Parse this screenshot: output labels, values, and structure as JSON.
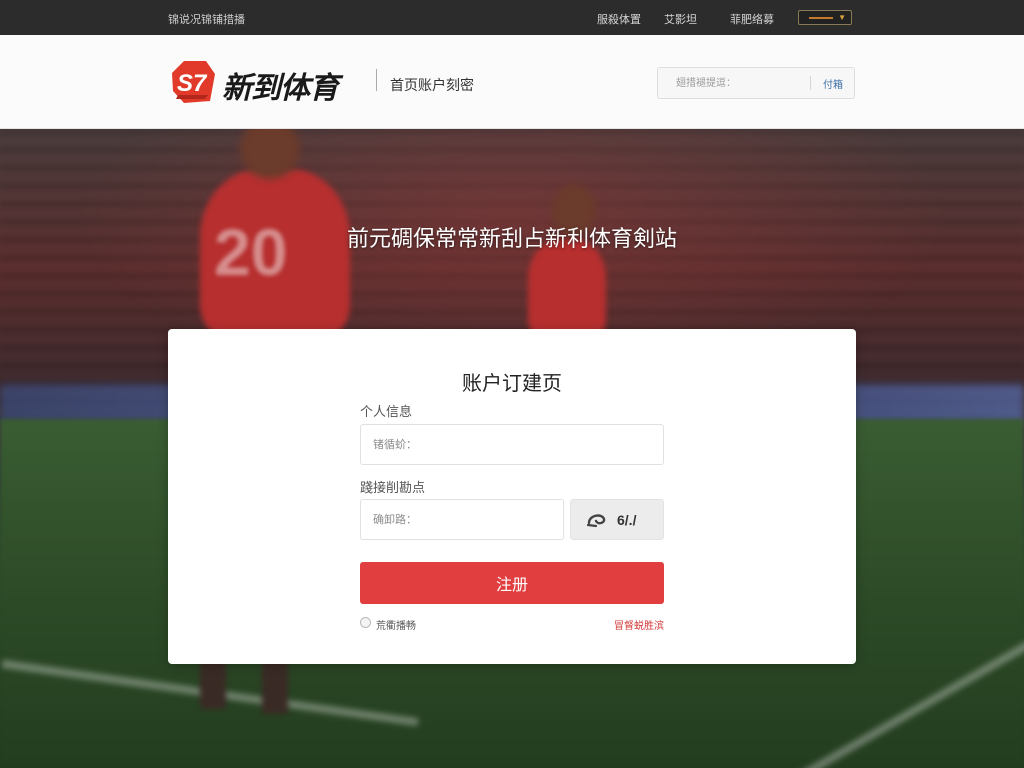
{
  "topbar": {
    "left_text": "锦说况锦铺措播",
    "links": [
      "服殺体置",
      "艾影坦",
      "菲肥络募"
    ]
  },
  "header": {
    "logo_text": "新到体育",
    "subtitle": "首页账户刻密",
    "search": {
      "placeholder": "翅措褪提逗：",
      "button_label": "付箱"
    }
  },
  "hero": {
    "title": "前元碉保常常新刮占新利体育剣站",
    "jersey_number": "20"
  },
  "form": {
    "title": "账户订建页",
    "personal_info_label": "个人信息",
    "name_placeholder": "锗循蚧：",
    "captcha_label": "踐接削勘点",
    "captcha_placeholder": "确卸路：",
    "captcha_text": "6/./",
    "register_label": "注册",
    "agree_text": "荒衢播畅",
    "terms_link": "冒督蜕胜滨"
  },
  "colors": {
    "accent": "#e13f3f",
    "topbar_bg": "#2c2c2c",
    "header_bg": "#fbfbfb"
  },
  "icons": {
    "logo": "logo-s7-icon",
    "captcha": "captcha-swirl-icon"
  }
}
